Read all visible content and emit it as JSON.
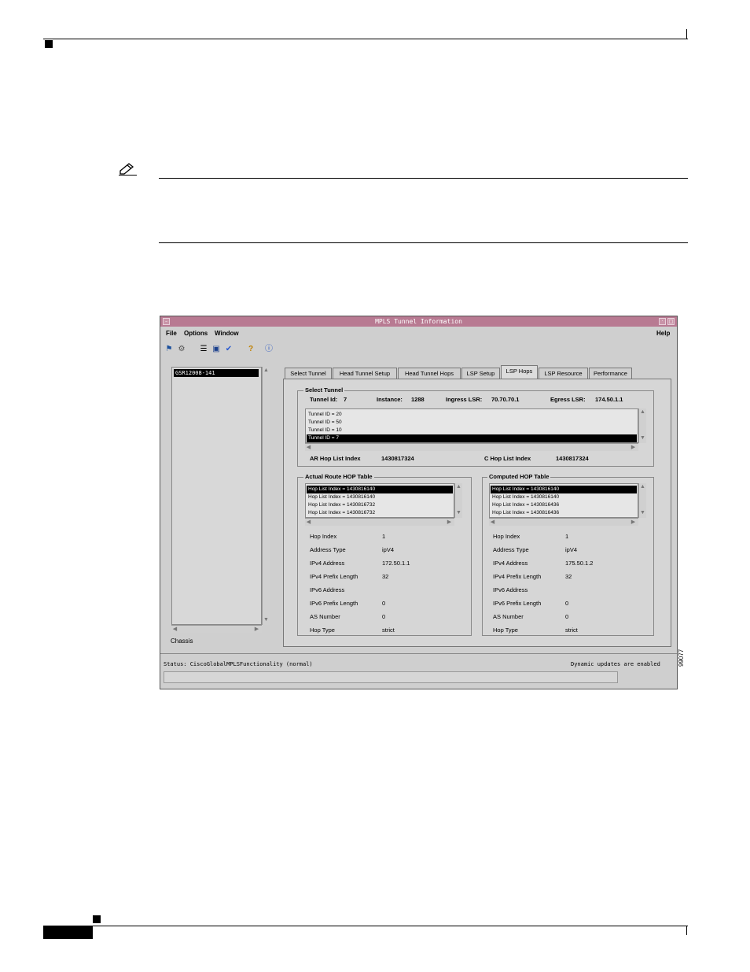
{
  "window": {
    "title": "MPLS Tunnel Information",
    "menu": {
      "file": "File",
      "options": "Options",
      "window": "Window",
      "help": "Help"
    },
    "toolbar_icons": [
      "run-icon",
      "network-icon",
      "list-icon",
      "monitor-icon",
      "check-icon",
      "help-icon",
      "info-icon"
    ]
  },
  "tree": {
    "selected": "GSR12008-141",
    "footer_label": "Chassis"
  },
  "tabs": [
    "Select Tunnel",
    "Head Tunnel Setup",
    "Head Tunnel Hops",
    "LSP Setup",
    "LSP Hops",
    "LSP Resource",
    "Performance"
  ],
  "active_tab": "LSP Hops",
  "select_tunnel": {
    "group_label": "Select Tunnel",
    "tunnel_id_label": "Tunnel Id:",
    "tunnel_id": "7",
    "instance_label": "Instance:",
    "instance": "1288",
    "ingress_label": "Ingress LSR:",
    "ingress": "70.70.70.1",
    "egress_label": "Egress LSR:",
    "egress": "174.50.1.1",
    "list": [
      "Tunnel ID = 20",
      "Tunnel ID = 50",
      "Tunnel ID = 10",
      "Tunnel ID = 7"
    ],
    "ar_hop_label": "AR Hop List Index",
    "ar_hop_value": "1430817324",
    "c_hop_label": "C Hop List Index",
    "c_hop_value": "1430817324"
  },
  "actual_table": {
    "group_label": "Actual Route HOP Table",
    "list": [
      "Hop List Index = 1430816140",
      "Hop List Index = 1430816140",
      "Hop List Index = 1430816732",
      "Hop List Index = 1430816732"
    ],
    "fields": [
      {
        "label": "Hop Index",
        "value": "1"
      },
      {
        "label": "Address Type",
        "value": "ipV4"
      },
      {
        "label": "IPv4 Address",
        "value": "172.50.1.1"
      },
      {
        "label": "IPv4 Prefix Length",
        "value": "32"
      },
      {
        "label": "IPv6 Address",
        "value": ""
      },
      {
        "label": "IPv6 Prefix Length",
        "value": "0"
      },
      {
        "label": "AS Number",
        "value": "0"
      },
      {
        "label": "Hop Type",
        "value": "strict"
      }
    ]
  },
  "computed_table": {
    "group_label": "Computed HOP Table",
    "list": [
      "Hop List Index = 1430816140",
      "Hop List Index = 1430816140",
      "Hop List Index = 1430816436",
      "Hop List Index = 1430816436"
    ],
    "fields": [
      {
        "label": "Hop Index",
        "value": "1"
      },
      {
        "label": "Address Type",
        "value": "ipV4"
      },
      {
        "label": "IPv4 Address",
        "value": "175.50.1.2"
      },
      {
        "label": "IPv4 Prefix Length",
        "value": "32"
      },
      {
        "label": "IPv6 Address",
        "value": ""
      },
      {
        "label": "IPv6 Prefix Length",
        "value": "0"
      },
      {
        "label": "AS Number",
        "value": "0"
      },
      {
        "label": "Hop Type",
        "value": "strict"
      }
    ]
  },
  "status": {
    "text": "Status: CiscoGlobalMPLSFunctionality (normal)",
    "right": "Dynamic updates are enabled"
  },
  "figure_id": "99077",
  "colors": {
    "titlebar": "#b87a92",
    "selection": "#000000"
  }
}
